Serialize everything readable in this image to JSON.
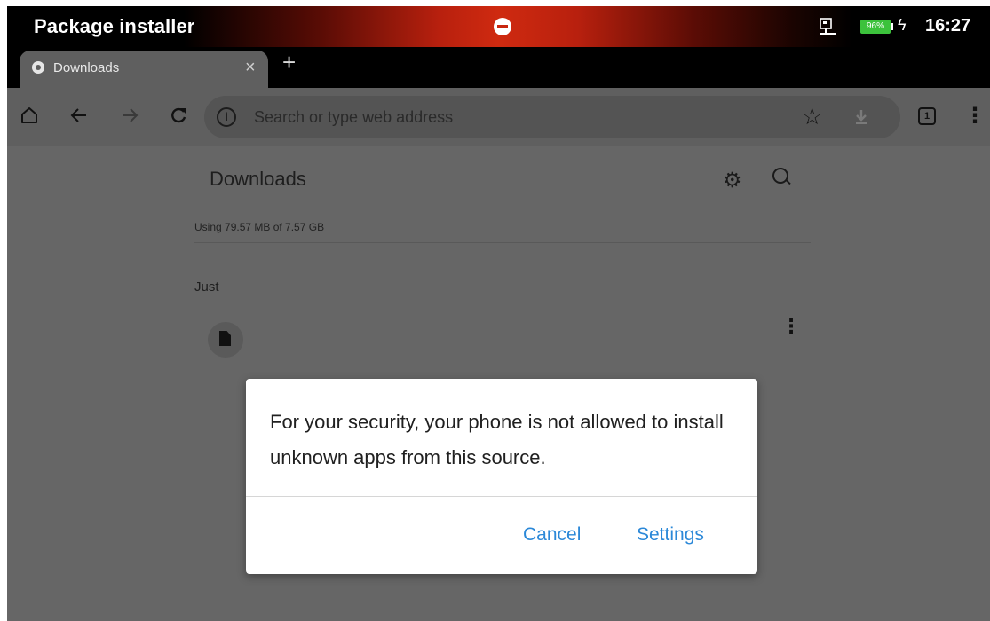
{
  "status_bar": {
    "app_title": "Package installer",
    "battery_percent": "96%",
    "time": "16:27",
    "battery_color": "#3cc23c"
  },
  "browser": {
    "tab": {
      "label": "Downloads",
      "close_glyph": "×"
    },
    "new_tab_glyph": "+",
    "toolbar": {
      "home_icon": "home-icon",
      "back_icon": "arrow-left-icon",
      "forward_icon": "arrow-right-icon",
      "reload_icon": "reload-icon",
      "omnibox_placeholder": "Search or type web address",
      "bookmark_icon": "star-icon",
      "download_icon": "download-icon",
      "tab_count": "1",
      "menu_icon": "more-vert-icon"
    }
  },
  "downloads_page": {
    "title": "Downloads",
    "storage_text": "Using 79.57 MB of 7.57 GB",
    "section_label": "Just"
  },
  "dialog": {
    "message": "For your security, your phone is not allowed to install unknown apps from this source.",
    "cancel_label": "Cancel",
    "settings_label": "Settings",
    "button_color": "#2b88d8"
  }
}
